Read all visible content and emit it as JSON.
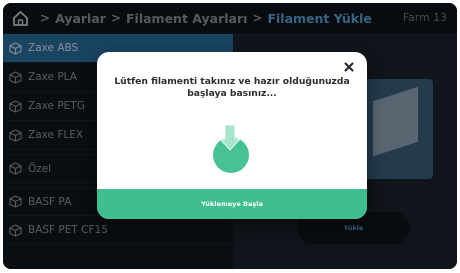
{
  "header": {
    "home_icon": "home-icon",
    "breadcrumbs": [
      "Ayarlar",
      "Filament Ayarları",
      "Filament Yükle"
    ],
    "separator": ">",
    "device_name": "Farm 13"
  },
  "sidebar": {
    "items": [
      {
        "label": "Zaxe ABS",
        "icon": "cube-icon",
        "active": true
      },
      {
        "label": "Zaxe PLA",
        "icon": "cube-icon",
        "active": false
      },
      {
        "label": "Zaxe PETG",
        "icon": "cube-icon",
        "active": false
      },
      {
        "label": "Zaxe FLEX",
        "icon": "cube-icon",
        "active": false
      },
      {
        "label": "Özel",
        "icon": "cube-icon",
        "active": false
      },
      {
        "label": "BASF PA",
        "icon": "cube-icon",
        "active": false
      },
      {
        "label": "BASF PET CF15",
        "icon": "cube-icon",
        "active": false
      }
    ]
  },
  "content": {
    "button_label": "Yükle"
  },
  "modal": {
    "message": "Lütfen filamenti takınız ve hazır olduğunuzda başlaya basınız...",
    "close_icon": "close-icon",
    "status_icon": "filament-load-icon",
    "start_button": "Yüklemeye Başla"
  },
  "colors": {
    "accent": "#3fbe90",
    "active_item": "#2b6f9e",
    "breadcrumb_active": "#5aa2cf"
  }
}
